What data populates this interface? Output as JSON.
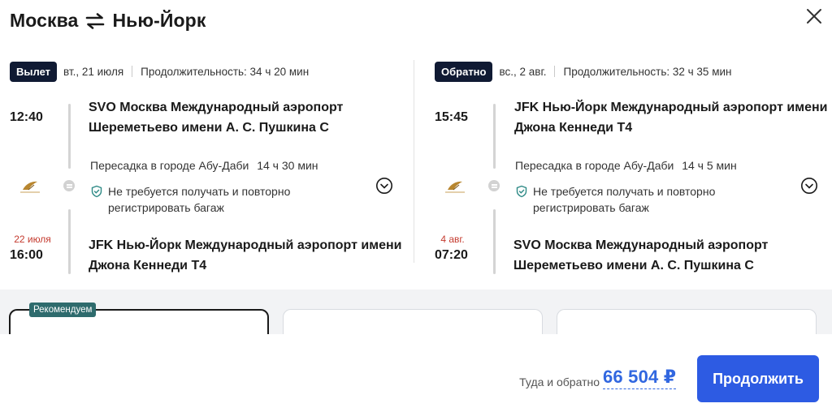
{
  "header": {
    "from": "Москва",
    "to": "Нью-Йорк"
  },
  "outbound": {
    "badge": "Вылет",
    "date": "вт., 21 июля",
    "duration": "Продолжительность: 34 ч 20 мин",
    "dep_time": "12:40",
    "dep_airport_line1": "SVO Москва Международный аэропорт",
    "dep_airport_line2": "Шереметьево имени А. С. Пушкина C",
    "transfer": "Пересадка в городе Абу-Даби",
    "transfer_duration": "14 ч 30 мин",
    "baggage_line1": "Не требуется получать и повторно",
    "baggage_line2": "регистрировать багаж",
    "arr_date": "22 июля",
    "arr_time": "16:00",
    "arr_airport_line1": "JFK Нью-Йорк Международный аэропорт имени",
    "arr_airport_line2": "Джона Кеннеди T4"
  },
  "return": {
    "badge": "Обратно",
    "date": "вс., 2 авг.",
    "duration": "Продолжительность: 32 ч 35 мин",
    "dep_time": "15:45",
    "dep_airport_line1": "JFK Нью-Йорк Международный аэропорт имени",
    "dep_airport_line2": "Джона Кеннеди T4",
    "transfer": "Пересадка в городе Абу-Даби",
    "transfer_duration": "14 ч 5 мин",
    "baggage_line1": "Не требуется получать и повторно",
    "baggage_line2": "регистрировать багаж",
    "arr_date": "4 авг.",
    "arr_time": "07:20",
    "arr_airport_line1": "SVO Москва Международный аэропорт",
    "arr_airport_line2": "Шереметьево имени А. С. Пушкина C"
  },
  "tariffs": {
    "recommend_label": "Рекомендуем"
  },
  "footer": {
    "total_label": "Туда и обратно",
    "price": "66 504 ₽",
    "continue_label": "Продолжить"
  },
  "colors": {
    "accent": "#2d5be3",
    "price": "#3167e0",
    "badge": "#101a33",
    "arrival_date": "#c43a2e",
    "recommend": "#2e6b6d"
  },
  "icons": [
    "swap-arrows-icon",
    "close-icon",
    "airline-logo-icon",
    "transfer-dot-icon",
    "shield-check-icon",
    "chevron-down-icon"
  ]
}
